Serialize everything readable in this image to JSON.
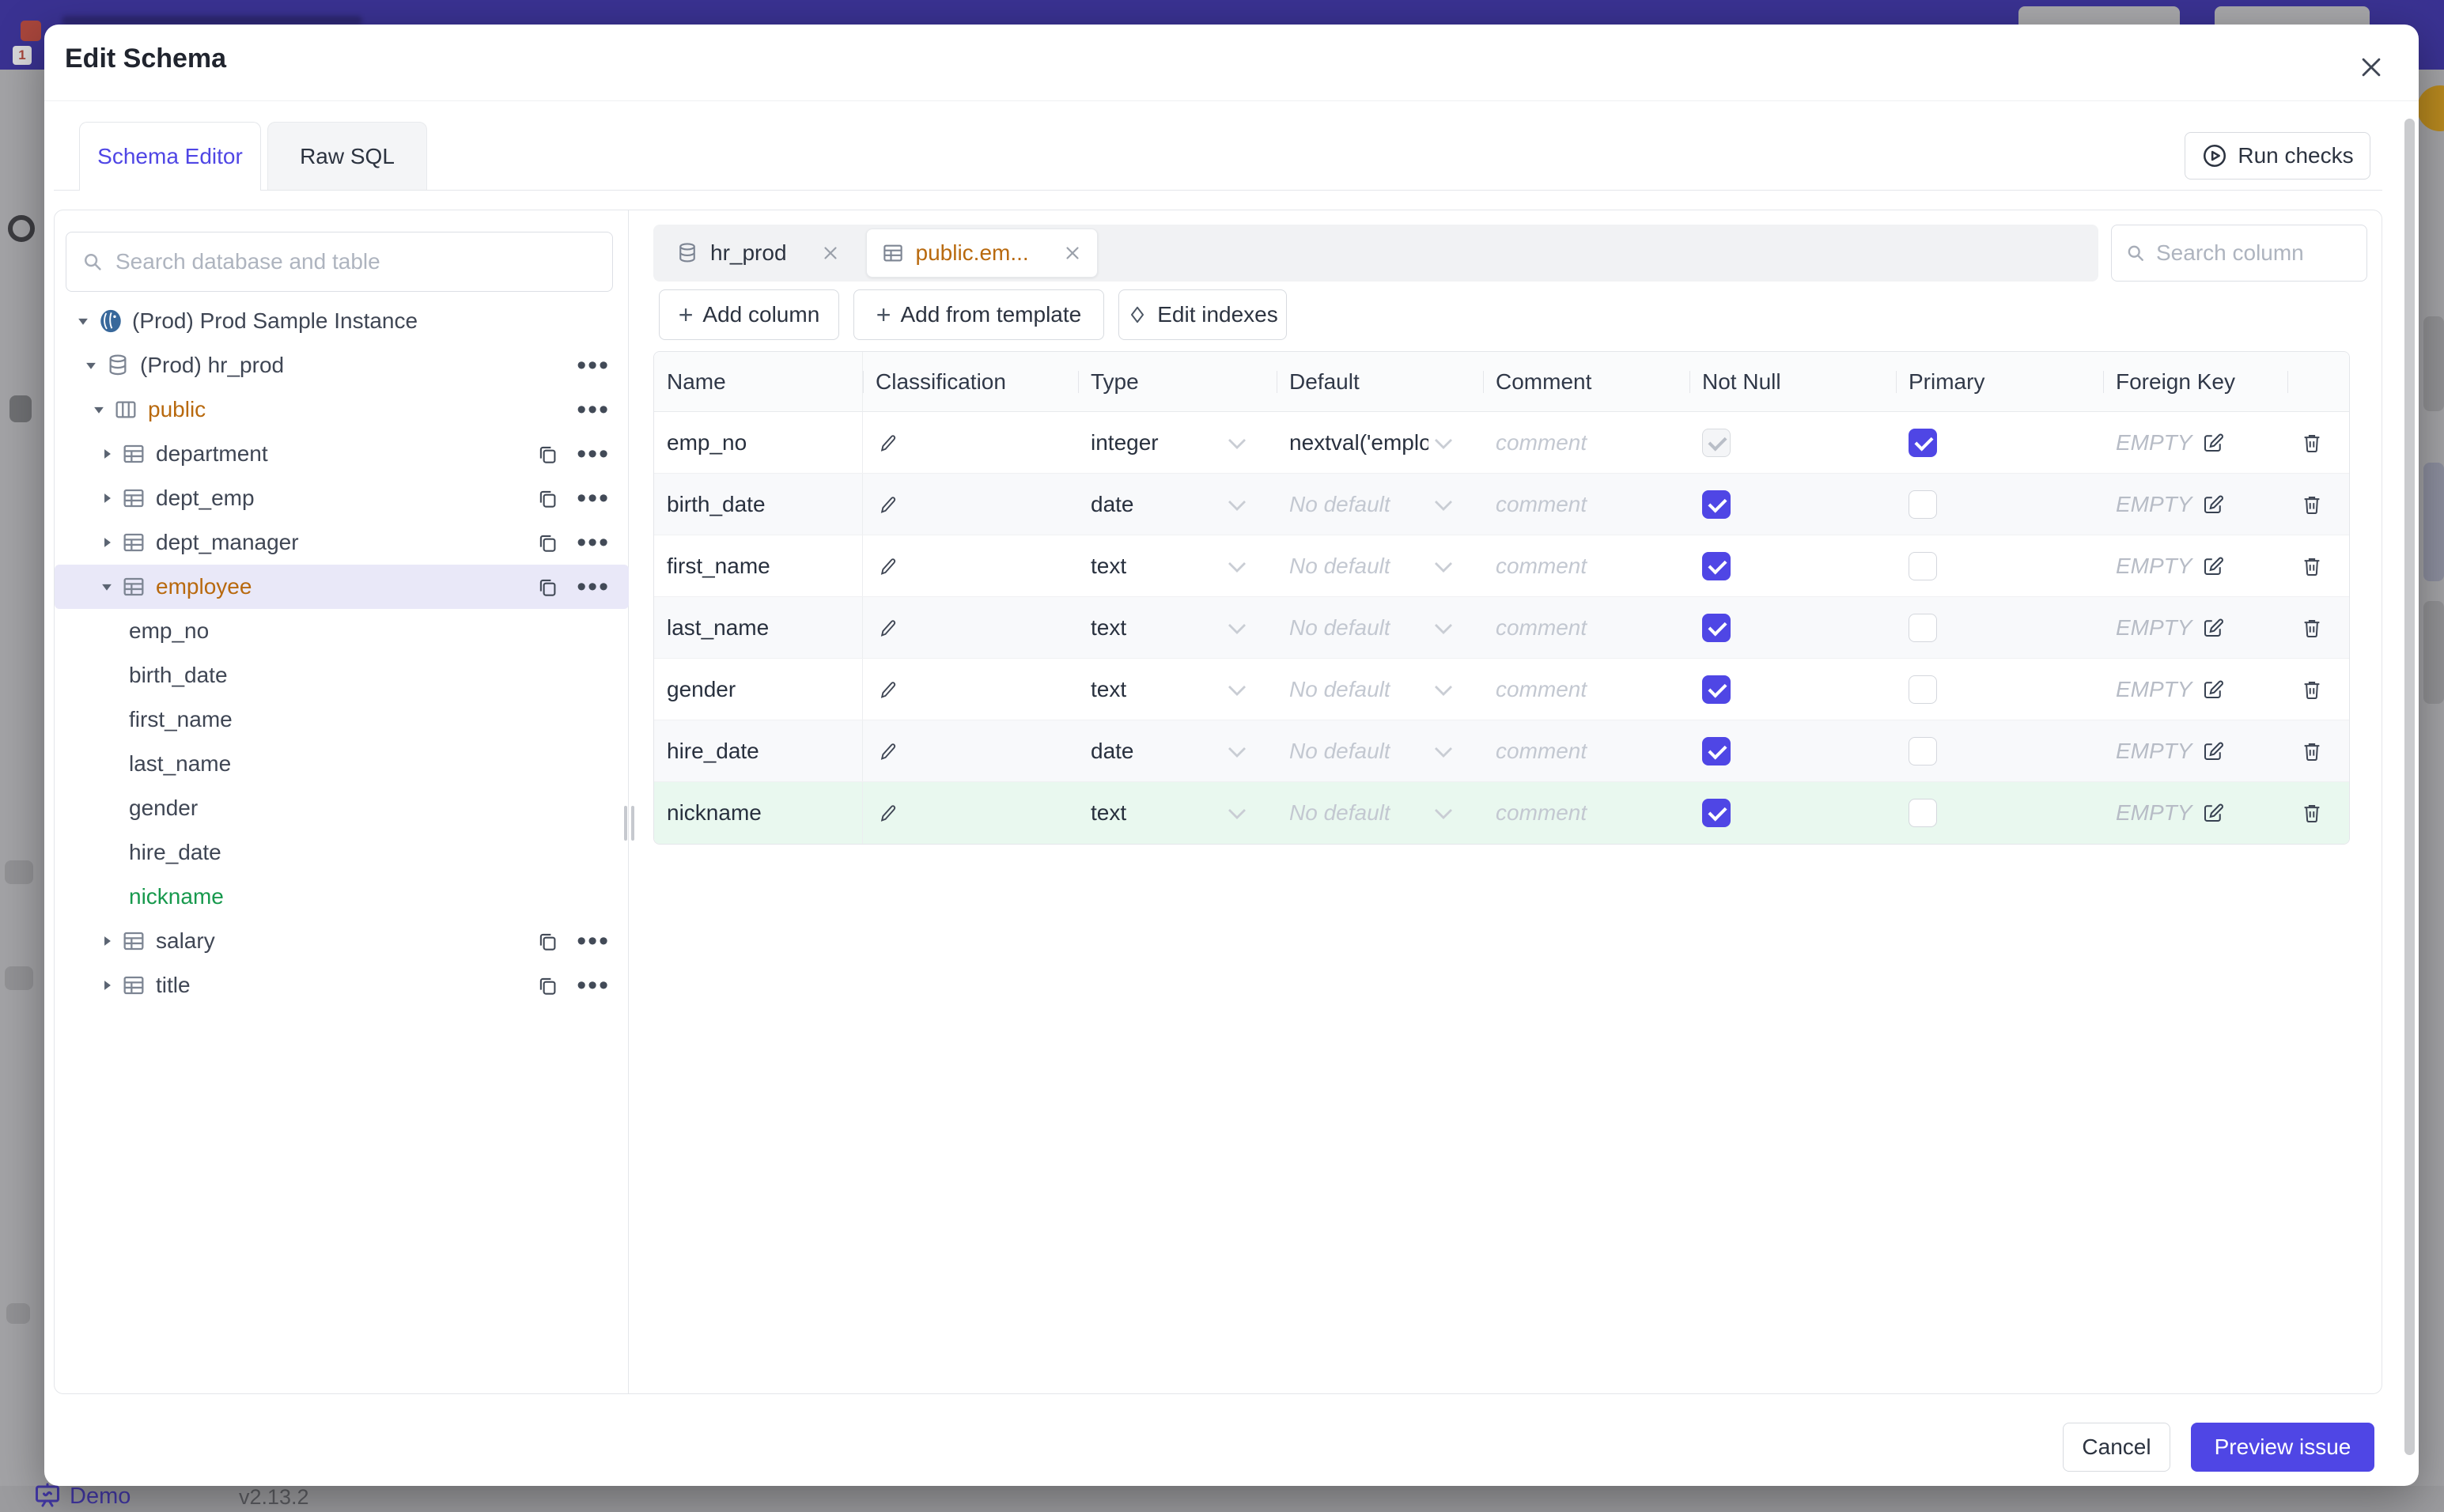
{
  "colors": {
    "accent": "#4f46e5",
    "amber_text": "#b8690e",
    "green_text": "#17994d",
    "selected_tree_row_bg": "#e9e8f8",
    "new_column_row_bg": "#e9f8ef",
    "topbar_dimmed": "#3a3292"
  },
  "icons": {
    "search": "magnifier",
    "close": "x-cross",
    "run_checks": "play-circle",
    "edit_indexes": "diamond",
    "add": "plus",
    "instance": "postgres-elephant",
    "database": "cylinder",
    "schema": "columns-grid",
    "table": "table-grid",
    "copy": "overlapping-squares",
    "more": "ellipsis",
    "classification_edit": "pencil",
    "dropdown": "chevron-down",
    "foreign_key_edit": "pencil-square",
    "delete": "trash",
    "demo": "presentation-board"
  },
  "backdrop": {
    "demo_label": "Demo",
    "version_label": "v2.13.2",
    "badge_count": "1"
  },
  "dialog": {
    "title": "Edit Schema",
    "tabs": [
      {
        "label": "Schema Editor",
        "active": true
      },
      {
        "label": "Raw SQL",
        "active": false
      }
    ],
    "run_checks_label": "Run checks"
  },
  "sidebar": {
    "search_placeholder": "Search database and table",
    "tree": [
      {
        "label": "(Prod) Prod Sample Instance",
        "type": "instance",
        "expanded": true
      },
      {
        "label": "(Prod) hr_prod",
        "type": "database",
        "expanded": true
      },
      {
        "label": "public",
        "type": "schema",
        "expanded": true
      },
      {
        "label": "department",
        "type": "table",
        "expanded": false
      },
      {
        "label": "dept_emp",
        "type": "table",
        "expanded": false
      },
      {
        "label": "dept_manager",
        "type": "table",
        "expanded": false
      },
      {
        "label": "employee",
        "type": "table",
        "expanded": true,
        "selected": true
      },
      {
        "label": "emp_no",
        "type": "column"
      },
      {
        "label": "birth_date",
        "type": "column"
      },
      {
        "label": "first_name",
        "type": "column"
      },
      {
        "label": "last_name",
        "type": "column"
      },
      {
        "label": "gender",
        "type": "column"
      },
      {
        "label": "hire_date",
        "type": "column"
      },
      {
        "label": "nickname",
        "type": "column",
        "new": true
      },
      {
        "label": "salary",
        "type": "table",
        "expanded": false
      },
      {
        "label": "title",
        "type": "table",
        "expanded": false
      }
    ]
  },
  "editor": {
    "chips": [
      {
        "label": "hr_prod",
        "kind": "database",
        "active": false
      },
      {
        "label": "public.em...",
        "kind": "table",
        "active": true
      }
    ],
    "column_search_placeholder": "Search column",
    "toolbar": {
      "add_column": "Add column",
      "add_from_template": "Add from template",
      "edit_indexes": "Edit indexes"
    },
    "table": {
      "headers": [
        "Name",
        "Classification",
        "Type",
        "Default",
        "Comment",
        "Not Null",
        "Primary",
        "Foreign Key"
      ],
      "comment_placeholder": "comment",
      "fk_empty_label": "EMPTY",
      "rows": [
        {
          "name": "emp_no",
          "type": "integer",
          "default": "nextval('employ",
          "default_is_placeholder": false,
          "not_null": true,
          "not_null_disabled": true,
          "primary": true,
          "is_new": false
        },
        {
          "name": "birth_date",
          "type": "date",
          "default": "No default",
          "default_is_placeholder": true,
          "not_null": true,
          "not_null_disabled": false,
          "primary": false,
          "is_new": false
        },
        {
          "name": "first_name",
          "type": "text",
          "default": "No default",
          "default_is_placeholder": true,
          "not_null": true,
          "not_null_disabled": false,
          "primary": false,
          "is_new": false
        },
        {
          "name": "last_name",
          "type": "text",
          "default": "No default",
          "default_is_placeholder": true,
          "not_null": true,
          "not_null_disabled": false,
          "primary": false,
          "is_new": false
        },
        {
          "name": "gender",
          "type": "text",
          "default": "No default",
          "default_is_placeholder": true,
          "not_null": true,
          "not_null_disabled": false,
          "primary": false,
          "is_new": false
        },
        {
          "name": "hire_date",
          "type": "date",
          "default": "No default",
          "default_is_placeholder": true,
          "not_null": true,
          "not_null_disabled": false,
          "primary": false,
          "is_new": false
        },
        {
          "name": "nickname",
          "type": "text",
          "default": "No default",
          "default_is_placeholder": true,
          "not_null": true,
          "not_null_disabled": false,
          "primary": false,
          "is_new": true
        }
      ]
    }
  },
  "footer": {
    "cancel_label": "Cancel",
    "preview_label": "Preview issue"
  }
}
